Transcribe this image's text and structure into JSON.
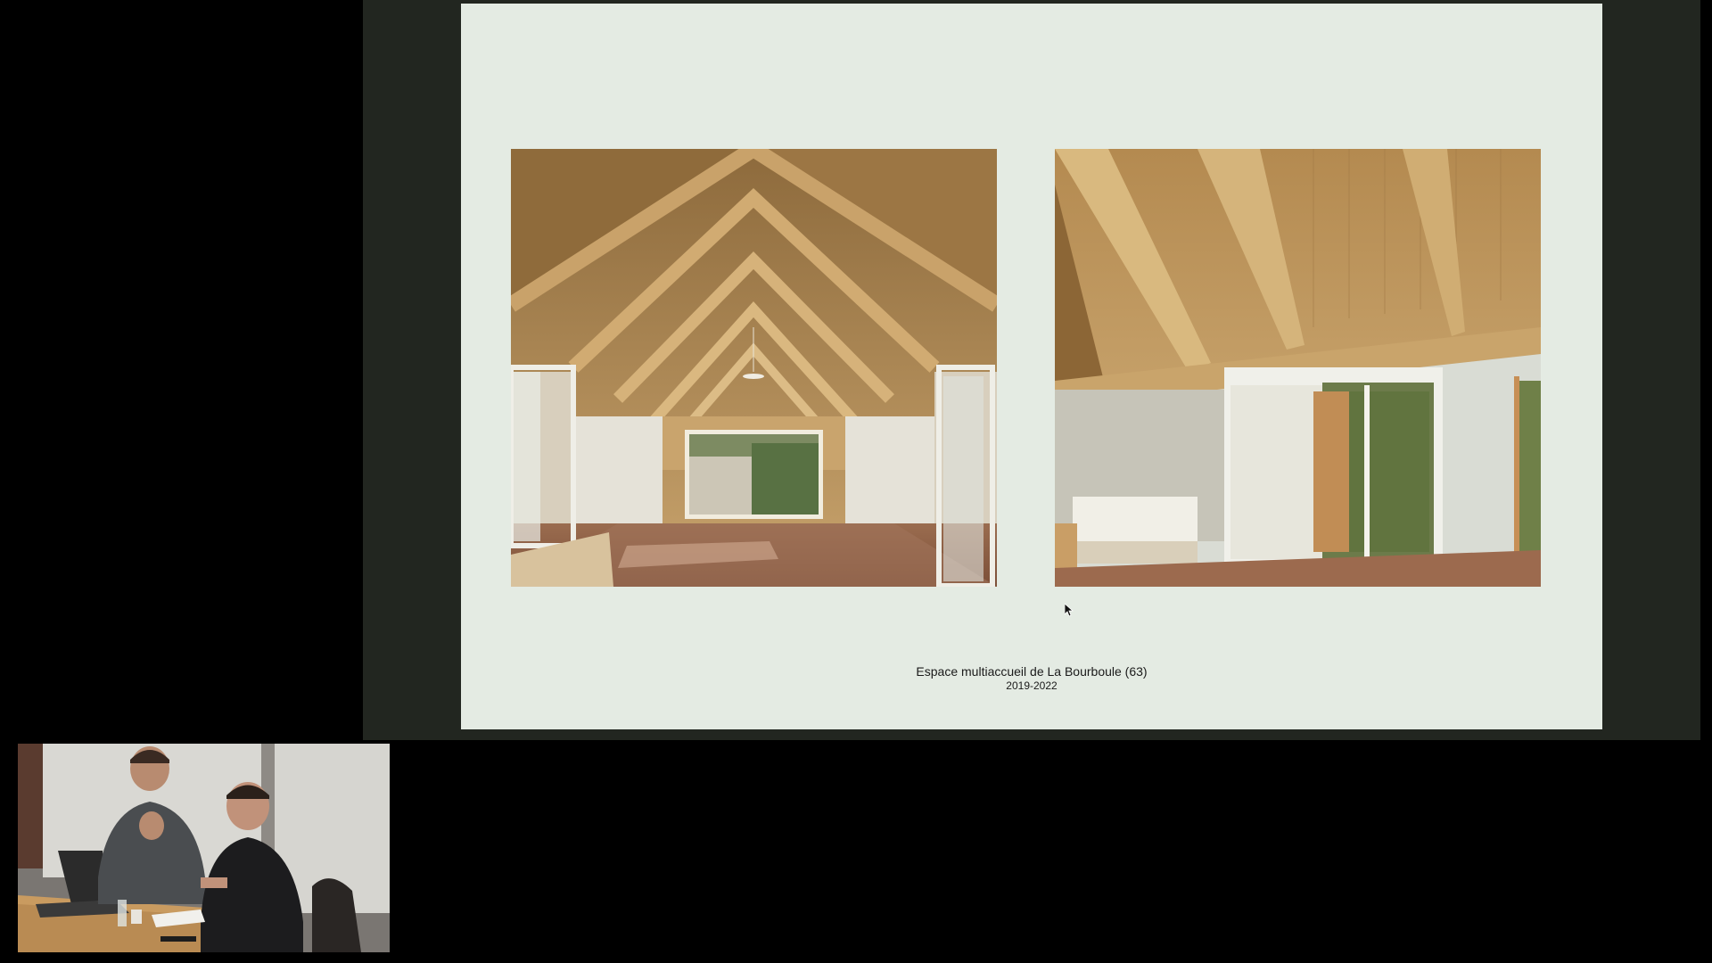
{
  "slide": {
    "caption_title": "Espace multiaccueil de La Bourboule (63)",
    "caption_years": "2019-2022",
    "photos": [
      {
        "name": "interior-gable-view"
      },
      {
        "name": "interior-corner-view"
      }
    ]
  },
  "webcam": {
    "participants": 2
  },
  "colors": {
    "frame": "#222620",
    "slide_bg": "#e4ebe3",
    "wood": "#b88f57",
    "floor": "#8a5a3e"
  }
}
